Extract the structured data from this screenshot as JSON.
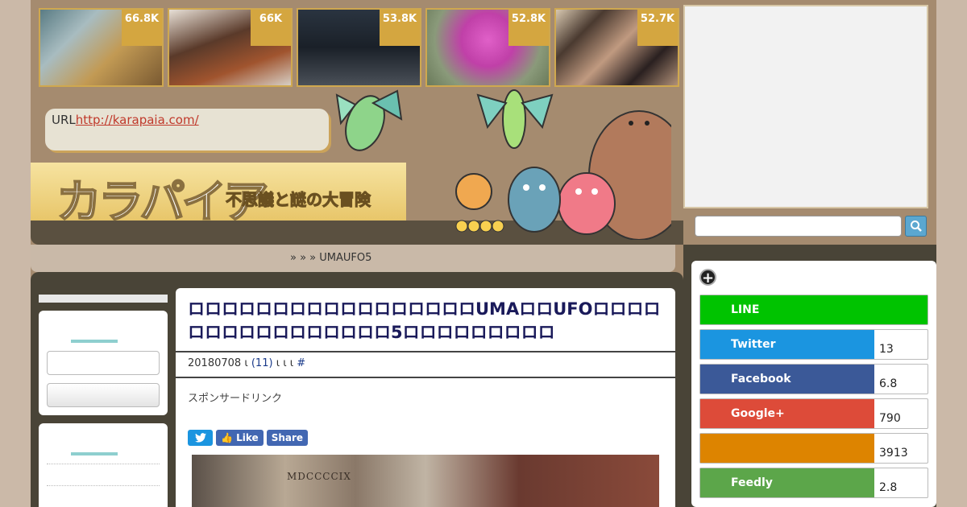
{
  "thumbnails": [
    {
      "count": "66.8K",
      "color_hint": "#8aa0a4"
    },
    {
      "count": "66K",
      "color_hint": "#6a4a3a"
    },
    {
      "count": "53.8K",
      "color_hint": "#2a3440"
    },
    {
      "count": "52.8K",
      "color_hint": "#d050b8"
    },
    {
      "count": "52.7K",
      "color_hint": "#8a7060"
    }
  ],
  "header": {
    "url_label": "URL",
    "url_link": "http://karapaia.com/",
    "logo_text": "カラパイア",
    "logo_subtitle": "不思議と謎の大冒険"
  },
  "breadcrumb": {
    "text": "»   »          » UMAUFO5"
  },
  "article": {
    "title": "ロロロロロロロロロロロロロロロロロUMAロロUFOロロロロロロロロロロロロロロロロ5ロロロロロロロロロ",
    "date": "20180708",
    "sep1": "ι",
    "comments": "(11)",
    "sep2": "ι ι        ι",
    "hash": "#",
    "sponsor": "スポンサードリンク",
    "twitter_btn": "",
    "like_btn": "Like",
    "share_btn": "Share",
    "photo_caption": "MDCCCCIX"
  },
  "sidebar_right": {
    "share_items": [
      {
        "label": "LINE",
        "count": "",
        "color": "#00c300"
      },
      {
        "label": "Twitter",
        "count": "13",
        "color": "#1b95e0"
      },
      {
        "label": "Facebook",
        "count": "6.8",
        "color": "#3b5998"
      },
      {
        "label": "Google+",
        "count": "790",
        "color": "#dd4b39"
      },
      {
        "label": "",
        "count": "3913",
        "color": "#dd8400"
      },
      {
        "label": "Feedly",
        "count": "2.8",
        "color": "#5ca64a"
      }
    ]
  },
  "colors": {
    "page_bg": "#cbb9a8",
    "frame": "#a58b6f",
    "dark_band": "#494437",
    "accent_gold": "#d4a640",
    "title_navy": "#1a1a5a"
  }
}
